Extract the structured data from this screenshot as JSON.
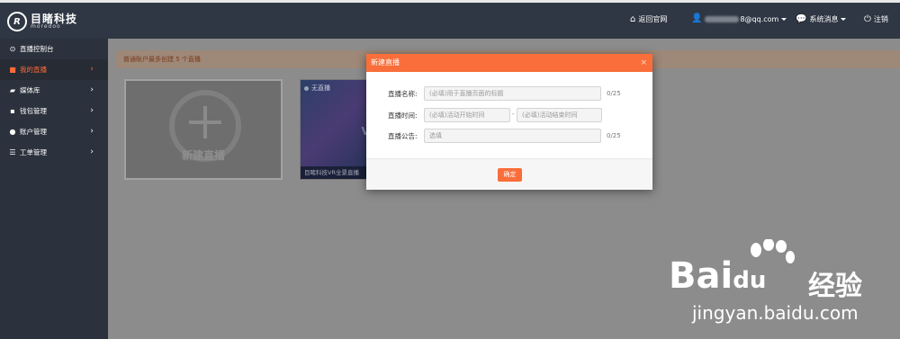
{
  "app": {
    "logo_cn": "目睹科技",
    "logo_en": "moredoo"
  },
  "topbar": {
    "back_site": "返回官网",
    "user_email": "8@qq.com",
    "messages": "系统消息",
    "logout": "注销"
  },
  "sidebar": {
    "items": [
      {
        "label": "直播控制台",
        "icon": "dashboard-icon",
        "active": false,
        "has_chevron": false
      },
      {
        "label": "我的直播",
        "icon": "video-camera-icon",
        "active": true,
        "has_chevron": true
      },
      {
        "label": "媒体库",
        "icon": "folder-icon",
        "active": false,
        "has_chevron": true
      },
      {
        "label": "钱包管理",
        "icon": "wallet-icon",
        "active": false,
        "has_chevron": true
      },
      {
        "label": "账户管理",
        "icon": "user-icon",
        "active": false,
        "has_chevron": true
      },
      {
        "label": "工单管理",
        "icon": "list-icon",
        "active": false,
        "has_chevron": true
      }
    ]
  },
  "main": {
    "notice": "普通账户最多创建 5 个直播",
    "new_live_label": "新建直播",
    "live_card": {
      "status": "无直播",
      "caption": "目睹科技VR全景直播",
      "overlay_text": "VR"
    }
  },
  "modal": {
    "title": "新建直播",
    "close": "×",
    "name_label": "直播名称:",
    "name_placeholder": "(必填)用于直播页面的标题",
    "name_count": "0/25",
    "time_label": "直播时间:",
    "start_placeholder": "(必填)活动开始时间",
    "time_separator": "-",
    "end_placeholder": "(必填)活动结束时间",
    "notice_label": "直播公告:",
    "notice_placeholder": "选填",
    "notice_count": "0/25",
    "confirm": "确定"
  },
  "watermark": {
    "baidu": "Bai",
    "baidu_tail": "du",
    "cn": "经验",
    "url": "jingyan.baidu.com"
  },
  "colors": {
    "accent": "#f96e3a",
    "topbar_bg": "#2f3744",
    "sidebar_bg": "#2c323d"
  }
}
